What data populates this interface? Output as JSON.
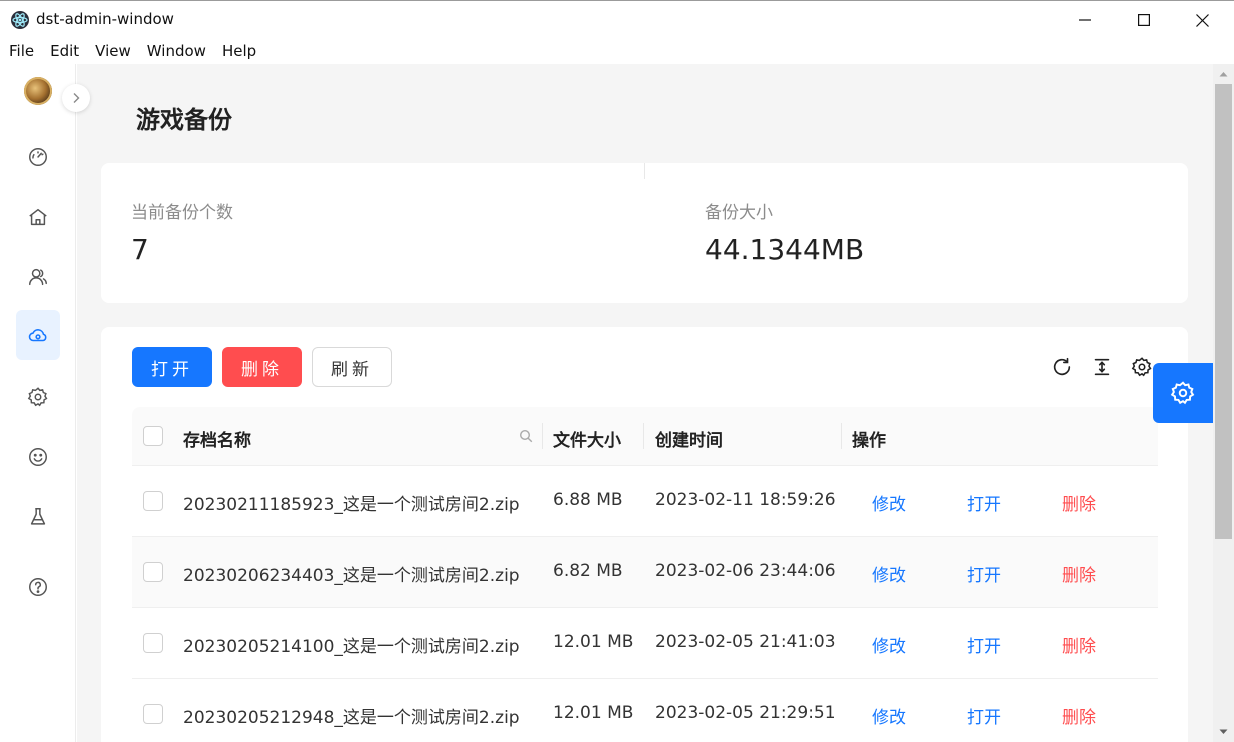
{
  "window": {
    "title": "dst-admin-window",
    "controls": {
      "minimize_icon": "minimize-icon",
      "maximize_icon": "maximize-icon",
      "close_icon": "close-icon"
    }
  },
  "menu": [
    "File",
    "Edit",
    "View",
    "Window",
    "Help"
  ],
  "sidebar": {
    "items": [
      {
        "name": "dashboard",
        "icon": "gauge-icon",
        "active": false
      },
      {
        "name": "home",
        "icon": "home-icon",
        "active": false
      },
      {
        "name": "players",
        "icon": "users-icon",
        "active": false
      },
      {
        "name": "backup",
        "icon": "cloud-icon",
        "active": true
      },
      {
        "name": "settings",
        "icon": "gear-icon",
        "active": false
      },
      {
        "name": "mods",
        "icon": "smile-icon",
        "active": false
      },
      {
        "name": "lab",
        "icon": "flask-icon",
        "active": false
      },
      {
        "name": "help",
        "icon": "help-icon",
        "active": false
      }
    ]
  },
  "page": {
    "title": "游戏备份"
  },
  "stats": {
    "count_label": "当前备份个数",
    "count_value": "7",
    "size_label": "备份大小",
    "size_value": "44.1344MB"
  },
  "toolbar": {
    "open_label": "打开",
    "delete_label": "删除",
    "refresh_label": "刷新"
  },
  "table": {
    "headers": {
      "name": "存档名称",
      "size": "文件大小",
      "created": "创建时间",
      "actions": "操作"
    },
    "action_labels": {
      "edit": "修改",
      "open": "打开",
      "delete": "删除"
    },
    "rows": [
      {
        "name": "20230211185923_这是一个测试房间2.zip",
        "size": "6.88 MB",
        "created": "2023-02-11 18:59:26"
      },
      {
        "name": "20230206234403_这是一个测试房间2.zip",
        "size": "6.82 MB",
        "created": "2023-02-06 23:44:06"
      },
      {
        "name": "20230205214100_这是一个测试房间2.zip",
        "size": "12.01 MB",
        "created": "2023-02-05 21:41:03"
      },
      {
        "name": "20230205212948_这是一个测试房间2.zip",
        "size": "12.01 MB",
        "created": "2023-02-05 21:29:51"
      }
    ]
  },
  "colors": {
    "primary": "#1677ff",
    "danger": "#ff4d4f",
    "active_bg": "#e8f2ff"
  }
}
